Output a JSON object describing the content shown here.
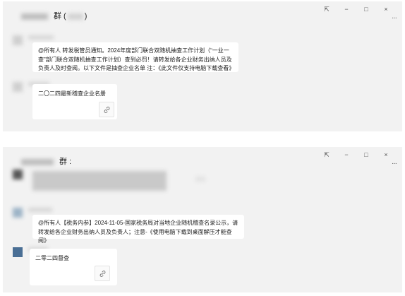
{
  "window_top": {
    "title_suffix": "群 (",
    "title_close": ")",
    "controls": {
      "pin": "⇱",
      "minimize": "−",
      "maximize": "□",
      "close": "×"
    },
    "more": "···",
    "message_text": "@所有人 转发税管员通知。2024年度部门联合双随机抽查工作计划（“一业一查”部门联合双随机抽查工作计划）查到必罚！请转发给各企业财务出纳人员及负责人及时查阅。以下文件是抽查企业名单 注：《此文件仅支持电脑下载查看》",
    "file_name": "二〇二四最新稽查企业名册"
  },
  "window_bottom": {
    "title_suffix": "群 :",
    "controls": {
      "pin": "⇱",
      "minimize": "−",
      "maximize": "□",
      "close": "×"
    },
    "more": "···",
    "message_text": "@所有人【税务内参】2024-11-05-国家税务局对当地企业随机稽查名录公示，请转发给各企业财务出纳人员及负责人；注意-《使用电脑下载到桌面解压才能查阅》",
    "file_name": "二零二四督查"
  }
}
